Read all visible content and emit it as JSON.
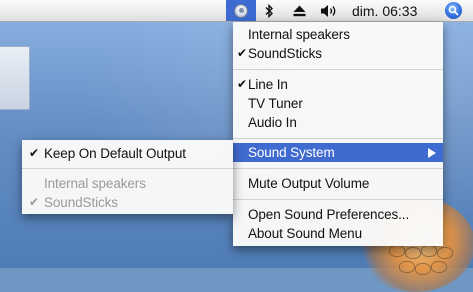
{
  "menubar": {
    "clock": "dim. 06:33",
    "icons": [
      "volume-menu-icon",
      "bluetooth-icon",
      "eject-icon",
      "speaker-icon",
      "spotlight-icon"
    ]
  },
  "main_menu": {
    "outputs": [
      {
        "label": "Internal speakers",
        "checked": false
      },
      {
        "label": "SoundSticks",
        "checked": true
      }
    ],
    "inputs": [
      {
        "label": "Line In",
        "checked": true
      },
      {
        "label": "TV Tuner",
        "checked": false
      },
      {
        "label": "Audio In",
        "checked": false
      }
    ],
    "sound_system": "Sound System",
    "mute": "Mute Output Volume",
    "preferences": "Open Sound Preferences...",
    "about": "About Sound Menu"
  },
  "sub_menu": {
    "keep_default": "Keep On Default Output",
    "items": [
      {
        "label": "Internal speakers",
        "checked": false
      },
      {
        "label": "SoundSticks",
        "checked": true
      }
    ]
  },
  "colors": {
    "highlight": "#3f6ad0",
    "disabled_text": "#9a9a9a"
  }
}
